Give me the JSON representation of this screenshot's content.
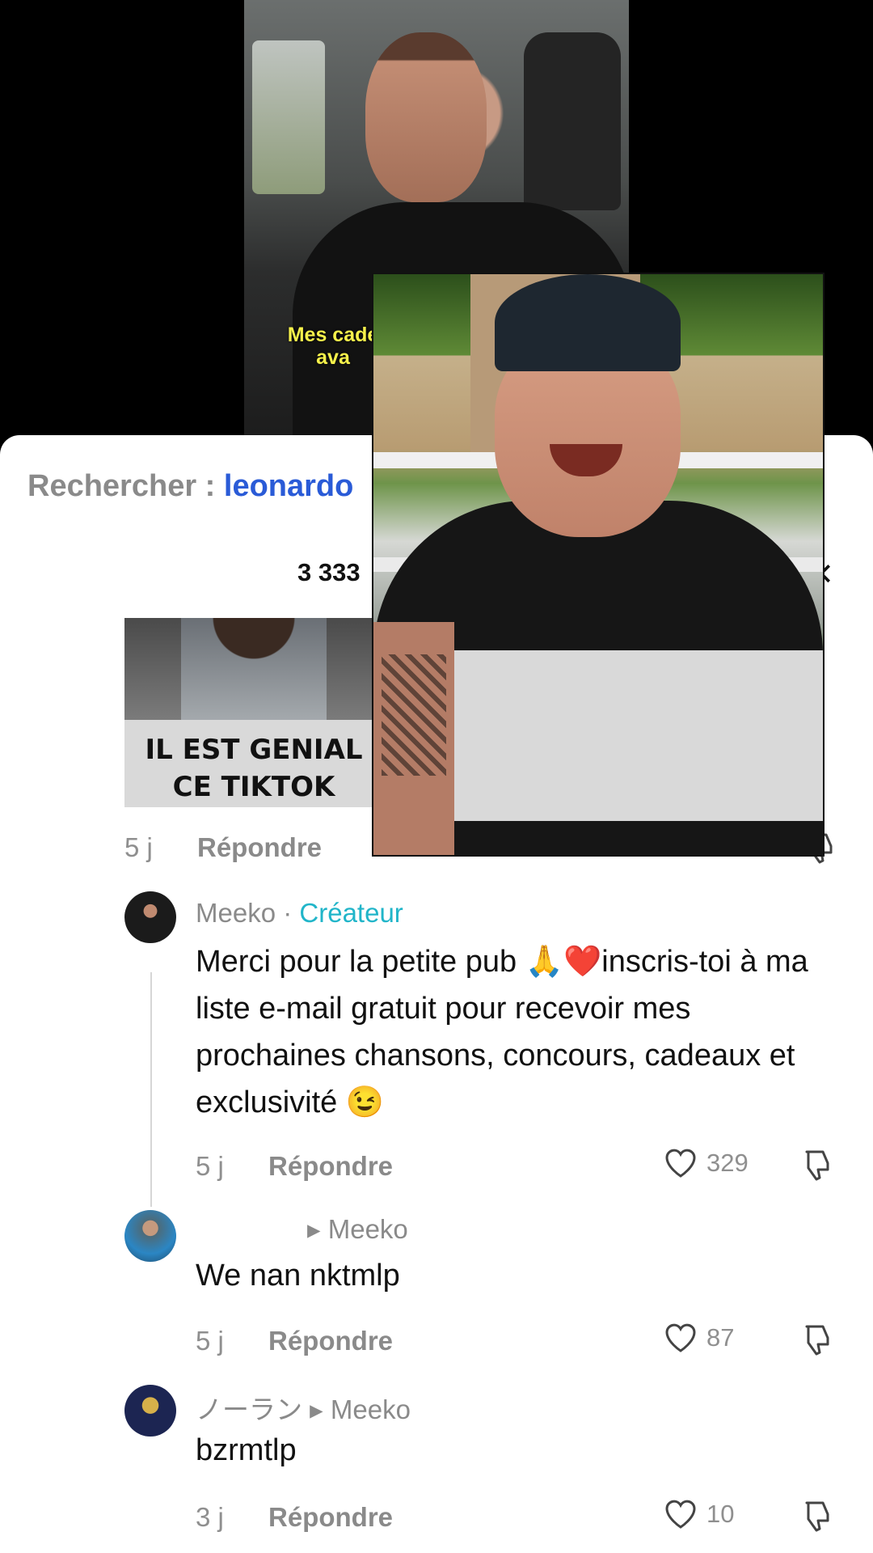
{
  "top_video": {
    "subtitle": "Mes cade\nava"
  },
  "search": {
    "prefix": "Rechercher :",
    "term": "leonardo"
  },
  "comments_count": "3 333",
  "thumb_caption": "IL EST GENIAL CE TIKTOK",
  "first_comment_meta": {
    "age": "5 j",
    "reply": "Répondre"
  },
  "comments": [
    {
      "username": "Meeko",
      "separator": " · ",
      "badge": "Créateur",
      "text": "Merci pour la petite pub 🙏❤️inscris-toi à ma liste e-mail gratuit pour recevoir mes prochaines chansons, concours, cadeaux et exclusivité 😉",
      "age": "5 j",
      "reply": "Répondre",
      "likes": "329"
    },
    {
      "username": "",
      "reply_to": "Meeko",
      "text": "We nan nktmlp",
      "age": "5 j",
      "reply": "Répondre",
      "likes": "87"
    },
    {
      "username": "ノーラン",
      "reply_to": "Meeko",
      "text": "bzrmtlp",
      "age": "3 j",
      "reply": "Répondre",
      "likes": "10"
    }
  ],
  "icons": {
    "heart": "heart-icon",
    "dislike": "dislike-icon",
    "close": "close-icon",
    "play": "caret-right-icon"
  },
  "colors": {
    "link": "#2a5bd7",
    "creator": "#21b5c9",
    "muted": "#8a8a8a"
  }
}
